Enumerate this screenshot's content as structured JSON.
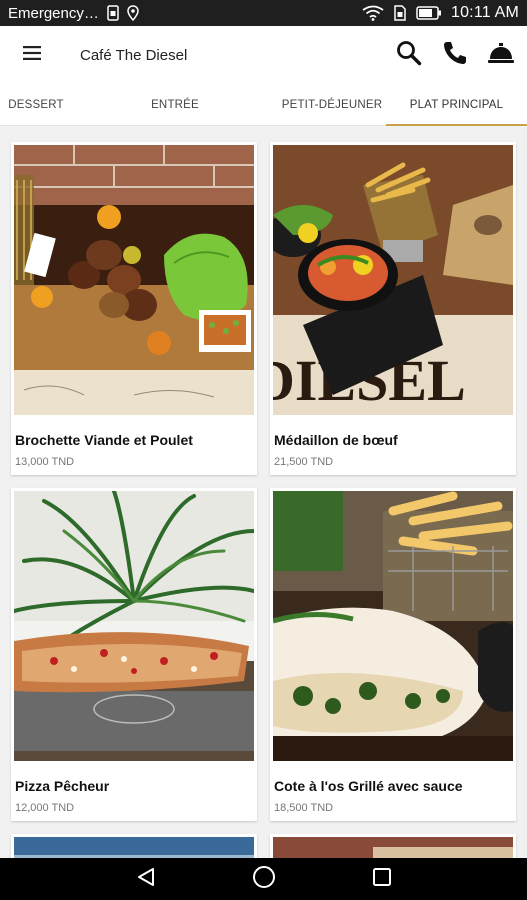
{
  "status_bar": {
    "carrier": "Emergency…",
    "time": "10:11 AM",
    "icons": [
      "sim-icon",
      "location-icon",
      "wifi-icon",
      "sim-card-icon",
      "battery-icon"
    ]
  },
  "app_bar": {
    "title": "Café The Diesel",
    "icons": [
      "menu-icon",
      "search-icon",
      "phone-icon",
      "service-bell-icon"
    ]
  },
  "tabs": [
    {
      "label": "DESSERT",
      "active": false
    },
    {
      "label": "ENTRÉE",
      "active": false
    },
    {
      "label": "PETIT-DÉJEUNER",
      "active": false
    },
    {
      "label": "PLAT PRINCIPAL",
      "active": true
    }
  ],
  "items": [
    {
      "name": "Brochette Viande et Poulet",
      "price": "13,000 TND"
    },
    {
      "name": "Médaillon de bœuf",
      "price": "21,500 TND"
    },
    {
      "name": "Pizza Pêcheur",
      "price": "12,000 TND"
    },
    {
      "name": "Cote à  l'os Grillé avec sauce",
      "price": "18,500 TND"
    }
  ],
  "colors": {
    "tab_indicator": "#c9a24a",
    "status_bar": "#1f1f1f",
    "background": "#f1f1f1"
  }
}
